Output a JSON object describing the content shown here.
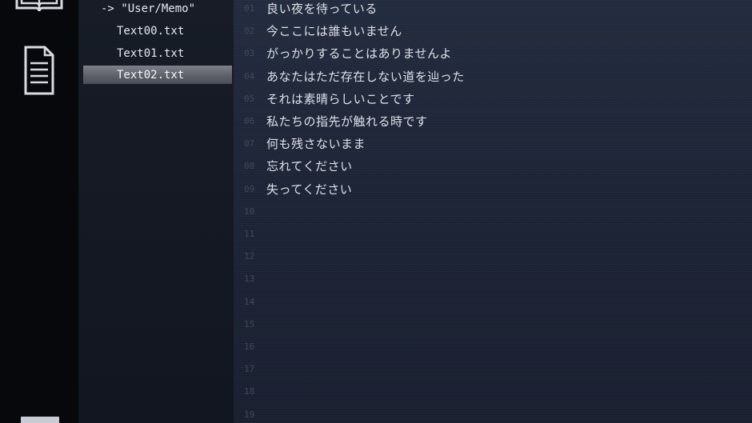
{
  "sidebar": {
    "icons": [
      "book-icon",
      "document-icon"
    ]
  },
  "file_tree": {
    "directory": "-> \"User/Memo\"",
    "files": [
      "Text00.txt",
      "Text01.txt",
      "Text02.txt"
    ],
    "selected": "Text02.txt"
  },
  "editor": {
    "line_numbers": [
      "01",
      "02",
      "03",
      "04",
      "05",
      "06",
      "07",
      "08",
      "09",
      "10",
      "11",
      "12",
      "13",
      "14",
      "15",
      "16",
      "17",
      "18",
      "19"
    ],
    "lines": [
      "良い夜を待っている",
      "今ここには誰もいません",
      "がっかりすることはありませんよ",
      "あなたはただ存在しない道を辿った",
      "それは素晴らしいことです",
      "私たちの指先が触れる時です",
      "何も残さないまま",
      "忘れてください",
      "失ってください"
    ]
  },
  "colors": {
    "rail": "#07080b",
    "tree_bg": "#171c27",
    "editor_bg": "#1d2436",
    "text": "#dde1e8",
    "line_number": "#3f4759",
    "selection": "#6a6d75"
  }
}
